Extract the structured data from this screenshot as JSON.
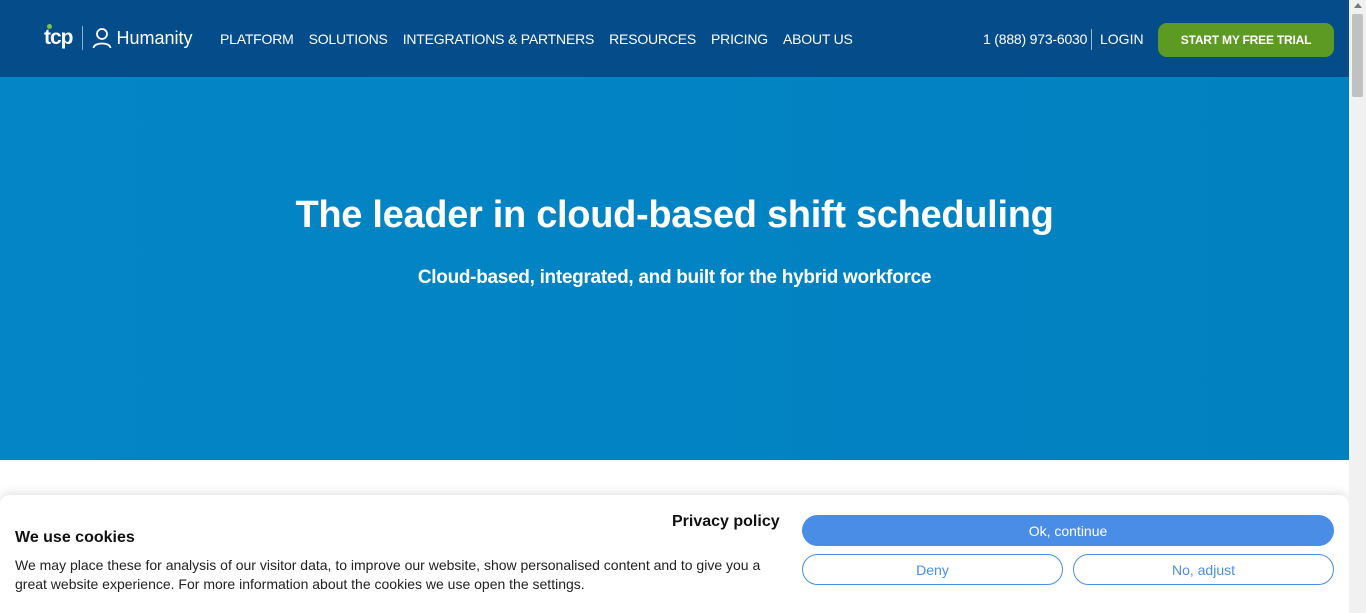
{
  "nav": {
    "logo_tcp": "tcp",
    "logo_name": "Humanity",
    "menu": [
      "PLATFORM",
      "SOLUTIONS",
      "INTEGRATIONS & PARTNERS",
      "RESOURCES",
      "PRICING",
      "ABOUT US"
    ],
    "phone": "1 (888) 973-6030",
    "login": "LOGIN",
    "trial_button": "START MY FREE TRIAL"
  },
  "hero": {
    "title": "The leader in cloud-based shift scheduling",
    "subtitle": "Cloud-based, integrated, and built for the hybrid workforce"
  },
  "cookie": {
    "title": "We use cookies",
    "text": "We may place these for analysis of our visitor data, to improve our website, show personalised content and to give you a great website experience. For more information about the cookies we use open the settings.",
    "privacy_link": "Privacy policy",
    "ok_button": "Ok, continue",
    "deny_button": "Deny",
    "adjust_button": "No, adjust"
  },
  "colors": {
    "nav_bg": "#054c8b",
    "hero_bg": "#0385c6",
    "trial_green": "#5d9a24",
    "cookie_accent": "#4a8de6"
  },
  "icons": [
    "user-icon",
    "tcp-logo"
  ]
}
